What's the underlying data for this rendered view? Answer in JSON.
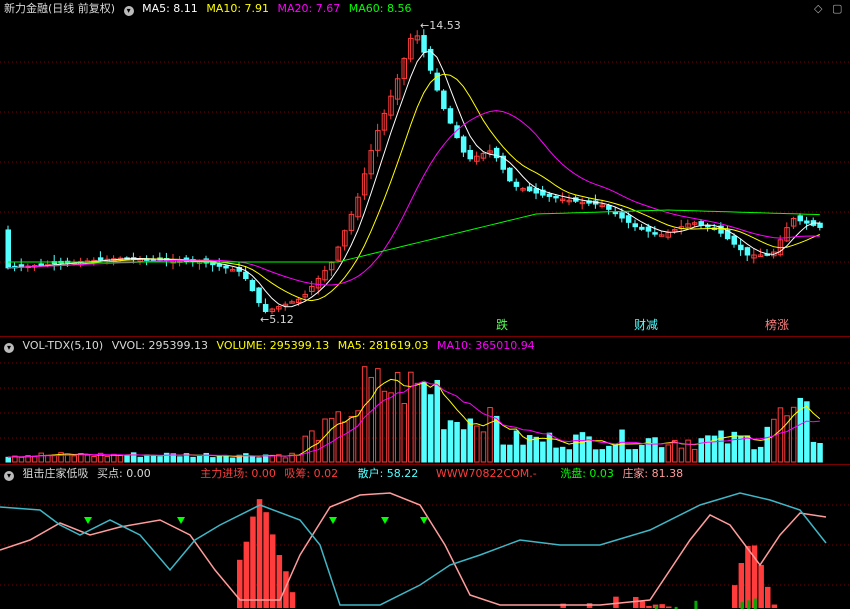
{
  "price_pane": {
    "title": "新力金融(日线 前复权)",
    "ma5": "MA5: 8.11",
    "ma10": "MA10: 7.91",
    "ma20": "MA20: 7.67",
    "ma60": "MA60: 8.56",
    "high_label": "14.53",
    "low_label": "5.12",
    "signal_labels": [
      "跌",
      "财减",
      "榜涨"
    ],
    "corner_icons": [
      "diamond-icon",
      "window-icon"
    ]
  },
  "volume_pane": {
    "title": "VOL-TDX(5,10)",
    "vvol": "VVOL: 295399.13",
    "volume": "VOLUME: 295399.13",
    "ma5": "MA5: 281619.03",
    "ma10": "MA10: 365010.94"
  },
  "indicator_pane": {
    "title": "狙击庄家低吸",
    "buy": "买点: 0.00",
    "main_entry": "主力进场: 0.00",
    "absorb": "吸筹: 0.02",
    "retail": "散户: 58.22",
    "website": "WWW70822COM.-",
    "wash": "洗盘: 0.03",
    "dealer": "庄家: 81.38"
  },
  "colors": {
    "up": "#ff3c3c",
    "down": "#54ffff",
    "ma5": "#ffffff",
    "ma10": "#ffff00",
    "ma20": "#ff00ff",
    "ma60": "#00ff00",
    "grid": "#7a0000"
  },
  "chart_data": {
    "type": "candlestick",
    "note_labels": [
      "14.53",
      "5.12"
    ],
    "price_ylim": [
      4.6,
      15.2
    ],
    "series": [
      {
        "name": "MA5",
        "value": 8.11
      },
      {
        "name": "MA10",
        "value": 7.91
      },
      {
        "name": "MA20",
        "value": 7.67
      },
      {
        "name": "MA60",
        "value": 8.56
      }
    ]
  }
}
